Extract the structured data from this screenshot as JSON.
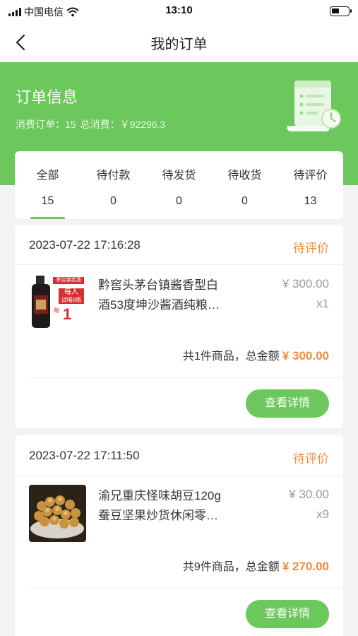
{
  "status_bar": {
    "carrier": "中国电信",
    "time": "13:10",
    "battery_level": 0.45
  },
  "nav": {
    "title": "我的订单"
  },
  "summary": {
    "title": "订单信息",
    "orders_label": "消费订单：15",
    "total_label": "总消费：￥92296.3"
  },
  "tabs": [
    {
      "label": "全部",
      "count": "15",
      "active": true
    },
    {
      "label": "待付款",
      "count": "0",
      "active": false
    },
    {
      "label": "待发货",
      "count": "0",
      "active": false
    },
    {
      "label": "待收货",
      "count": "0",
      "active": false
    },
    {
      "label": "待评价",
      "count": "13",
      "active": false
    }
  ],
  "orders": [
    {
      "datetime": "2023-07-22 17:16:28",
      "status": "待评价",
      "name_line1": "黔窖头茅台镇酱香型白",
      "name_line2": "酒53度坤沙酱酒纯粮…",
      "price": "¥ 300.00",
      "qty": "x1",
      "summary_label": "共1件商品，总金额",
      "total": "¥ 300.00",
      "button": "查看详情",
      "thumb": {
        "banner": "茅台镇老酒",
        "line1": "每人",
        "line2": "试喝6瓶",
        "line3": "1",
        "side": "每"
      }
    },
    {
      "datetime": "2023-07-22 17:11:50",
      "status": "待评价",
      "name_line1": "渝兄重庆怪味胡豆120g",
      "name_line2": "蚕豆坚果炒货休闲零…",
      "price": "¥ 30.00",
      "qty": "x9",
      "summary_label": "共9件商品，总金额",
      "total": "¥ 270.00",
      "button": "查看详情"
    }
  ],
  "colors": {
    "accent": "#6cc75c",
    "status": "#f08c3a"
  }
}
